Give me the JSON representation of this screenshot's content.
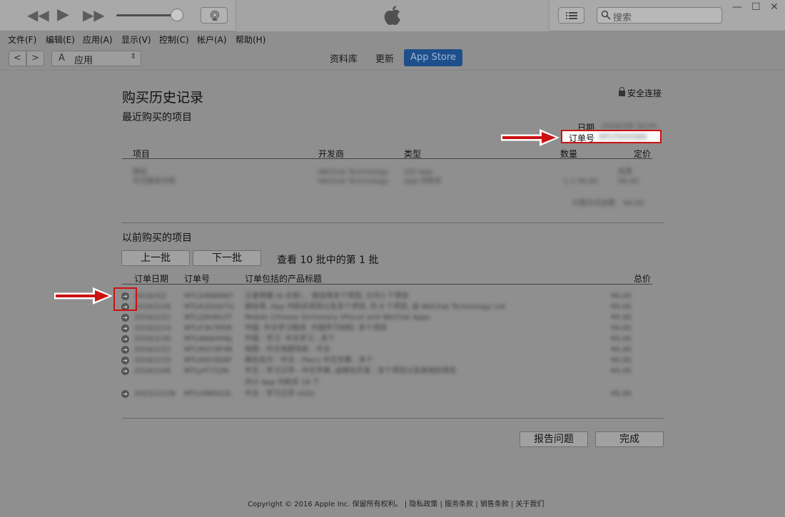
{
  "player": {
    "rewind_icon": "◀◀",
    "play_icon": "▶",
    "forward_icon": "▶▶",
    "volume_level": 0.9,
    "search_placeholder": "搜索"
  },
  "window_controls": {
    "minimize": "—",
    "maximize": "☐",
    "close": "✕"
  },
  "menu": [
    "文件(F)",
    "编辑(E)",
    "应用(A)",
    "显示(V)",
    "控制(C)",
    "帐户(A)",
    "帮助(H)"
  ],
  "nav": {
    "back": "<",
    "forward": ">",
    "media_icon": "A",
    "media_label": "应用",
    "tabs": [
      "资料库",
      "更新",
      "App Store"
    ],
    "active_tab": "App Store"
  },
  "page": {
    "title": "购买历史记录",
    "secure": "安全连接",
    "recent_heading": "最近购买的项目",
    "date_label": "日期",
    "date_value": "2016/3/8 16:54",
    "order_label": "订单号",
    "order_value": "MTLT5HH5B9",
    "recent_columns": [
      "项目",
      "开发商",
      "类型",
      "数量",
      "定价"
    ],
    "recent_items": [
      {
        "item": "微信",
        "developer": "WeChat Technology",
        "type": "iOS App",
        "qty": "",
        "price": "免费"
      },
      {
        "item": "中文版本内容",
        "developer": "WeChat Technology",
        "type": "App 内购买",
        "qty": "1 x ¥6.00",
        "price": "¥6.00"
      }
    ],
    "recent_total_label": "付费方式总额",
    "recent_total_value": "¥6.00",
    "past_heading": "以前购买的项目",
    "prev_batch": "上一批",
    "next_batch": "下一批",
    "batch_status": "查看 10 批中的第 1 批",
    "past_columns": [
      "订单日期",
      "订单号",
      "订单包括的产品标题",
      "总价"
    ],
    "past_orders": [
      {
        "date": "2016/3/2",
        "id": "MTLS4N8W87",
        "title": "王者荣耀 (6 点券) 、微信等多个项目, 分为3 个项目",
        "total": "¥6.00"
      },
      {
        "date": "2016/2/28",
        "id": "MTLR2DQV7G",
        "title": "微信等, App 内购买项目以及多个项目, 共 8 个项目, 由 WeChat Technology Ltd",
        "total": "¥0.00"
      },
      {
        "date": "2016/2/21",
        "id": "MTLQ9X8V2T",
        "title": "Mobile Chinese Dictionary (Pleco) and WeChat Apps",
        "total": "¥0.00"
      },
      {
        "date": "2016/2/14",
        "id": "MTLP3K7M5R",
        "title": "中国. 中文学习程序. 中国学习材料: 多个项目",
        "total": "¥0.00"
      },
      {
        "date": "2016/1/30",
        "id": "MTLN8W4H6J",
        "title": "中国 - 学习. 中文学习 - 多个",
        "total": "¥0.00"
      },
      {
        "date": "2016/1/22",
        "id": "MTLM2C9F4B",
        "title": "地图 - 中文地图导航 - 中文",
        "total": "¥0.00"
      },
      {
        "date": "2016/1/15",
        "id": "MTLK6V3D8P",
        "title": "微信支付 - 中文 - Pleco 中文字典 - 多个",
        "total": "¥0.00"
      },
      {
        "date": "2016/1/08",
        "id": "MTLJ4T7S2N",
        "title": "中文 - 学习汉字 - 中文字典, 由微信开发 - 多个项目以及其他的项目",
        "total": "¥0.00"
      },
      {
        "date": "",
        "id": "",
        "title": "共计 App 内购买 18 个",
        "total": ""
      },
      {
        "date": "2015/12/28",
        "id": "MTLH9R5Q3L",
        "title": "中文 - 学习汉字 (iOS)",
        "total": "¥0.00"
      }
    ],
    "report_button": "报告问题",
    "done_button": "完成",
    "footer": "Copyright © 2016 Apple Inc. 保留所有权利。 | 隐私政策 | 服务条款 | 销售条款 | 关于我们"
  }
}
